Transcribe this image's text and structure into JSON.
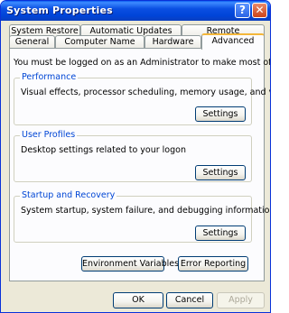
{
  "window": {
    "title": "System Properties",
    "help_glyph": "?",
    "close_glyph": "✕"
  },
  "tabs": {
    "row1": [
      "System Restore",
      "Automatic Updates",
      "Remote"
    ],
    "row2": [
      "General",
      "Computer Name",
      "Hardware",
      "Advanced"
    ],
    "selected": "Advanced"
  },
  "content": {
    "notice": "You must be logged on as an Administrator to make most of these changes.",
    "groups": [
      {
        "title": "Performance",
        "description": "Visual effects, processor scheduling, memory usage, and virtual memory",
        "button": "Settings"
      },
      {
        "title": "User Profiles",
        "description": "Desktop settings related to your logon",
        "button": "Settings"
      },
      {
        "title": "Startup and Recovery",
        "description": "System startup, system failure, and debugging information",
        "button": "Settings"
      }
    ],
    "env_button": "Environment Variables",
    "error_button": "Error Reporting"
  },
  "footer": {
    "ok": "OK",
    "cancel": "Cancel",
    "apply": "Apply",
    "apply_enabled": false
  },
  "colors": {
    "titlebar": "#0054e3",
    "dialog_bg": "#ece9d8",
    "panel_bg": "#fcfcfe",
    "group_label": "#0046d5",
    "active_tab_accent": "#f3b73a"
  }
}
